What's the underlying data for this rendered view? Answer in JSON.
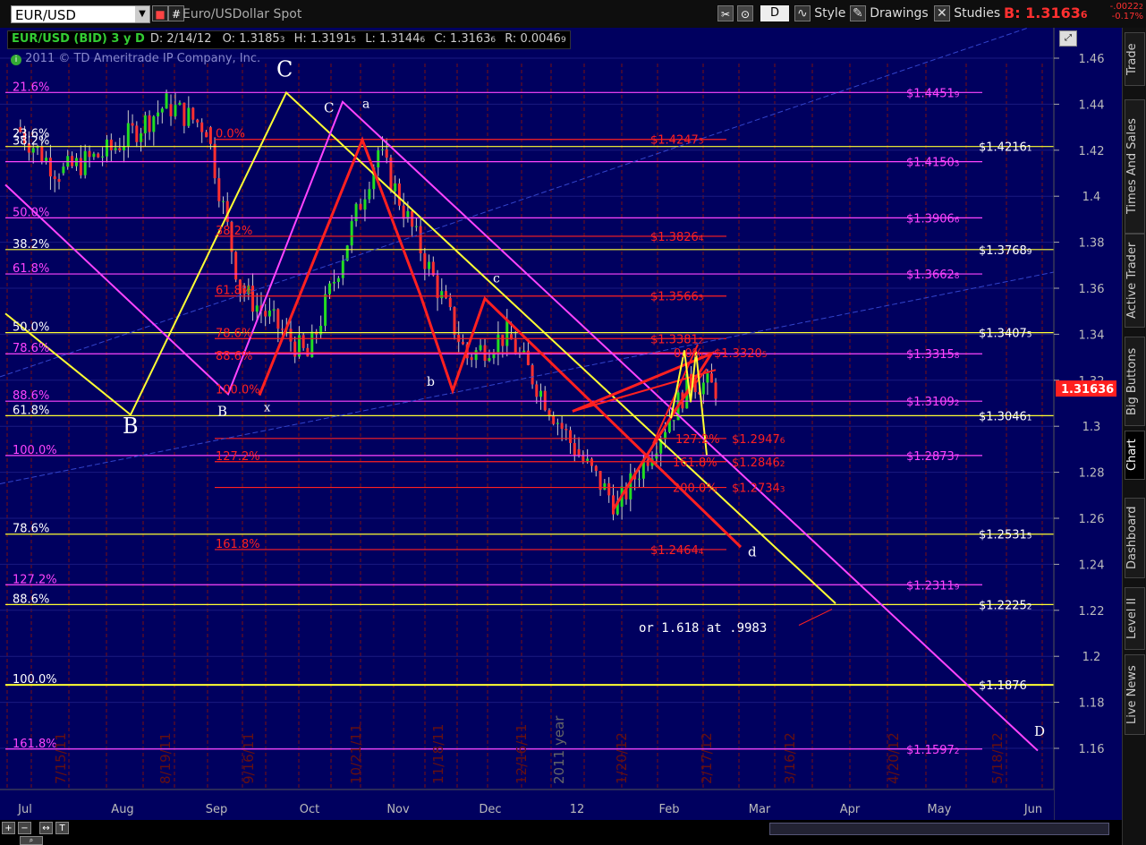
{
  "toolbar": {
    "symbol": "EUR/USD",
    "description": "Euro/USDollar Spot",
    "period_btn": "D",
    "style_label": "Style",
    "drawings_label": "Drawings",
    "studies_label": "Studies",
    "bid_label": "B: 1.3163",
    "bid_sub": "6",
    "change": "-.0022",
    "change_sub": "2",
    "change_pct": "-0.17%"
  },
  "header": {
    "title": "EUR/USD (BID) 3 y D",
    "date": "D: 2/14/12",
    "open": "O: 1.3185",
    "open_sub": "3",
    "high": "H: 1.3191",
    "high_sub": "5",
    "low": "L: 1.3144",
    "low_sub": "6",
    "close": "C: 1.3163",
    "close_sub": "6",
    "range": "R: 0.0046",
    "range_sub": "9",
    "copyright": "2011 © TD Ameritrade IP Company, Inc."
  },
  "sidebar": {
    "tabs": [
      "Trade",
      "Times And Sales",
      "Active Trader",
      "Big Buttons",
      "Chart",
      "Dashboard",
      "Level II",
      "Live News"
    ],
    "active": "Chart"
  },
  "colors": {
    "background": "#00005f",
    "grid": "#7a1010",
    "yellow": "#ffff33",
    "magenta": "#ff44ff",
    "red": "#ff2020",
    "price_box": "#ff2020"
  },
  "chart_data": {
    "type": "candlestick",
    "symbol": "EUR/USD (BID)",
    "ylim": [
      1.155,
      1.475
    ],
    "y_ticks": [
      "1.46",
      "1.44",
      "1.42",
      "1.4",
      "1.38",
      "1.36",
      "1.34",
      "1.32",
      "1.3",
      "1.28",
      "1.26",
      "1.24",
      "1.22",
      "1.2",
      "1.18",
      "1.16"
    ],
    "x_month_labels": [
      "Jul",
      "Aug",
      "Sep",
      "Oct",
      "Nov",
      "Dec",
      "12",
      "Feb",
      "Mar",
      "Apr",
      "May",
      "Jun"
    ],
    "x_date_labels": [
      "7/15/11",
      "8/19/11",
      "9/16/11",
      "10/21/11",
      "11/18/11",
      "12/16/11",
      "2011 year",
      "1/20/12",
      "2/17/12",
      "3/16/12",
      "4/20/12",
      "5/18/12"
    ],
    "last_price": "1.3163",
    "last_price_sub": "6",
    "candles_approx": [
      {
        "date": "2011-07-01",
        "close": 1.43
      },
      {
        "date": "2011-07-15",
        "close": 1.41
      },
      {
        "date": "2011-08-01",
        "close": 1.42
      },
      {
        "date": "2011-08-19",
        "close": 1.44
      },
      {
        "date": "2011-09-01",
        "close": 1.43
      },
      {
        "date": "2011-09-12",
        "close": 1.36
      },
      {
        "date": "2011-10-04",
        "close": 1.33
      },
      {
        "date": "2011-10-27",
        "close": 1.42
      },
      {
        "date": "2011-11-25",
        "close": 1.33
      },
      {
        "date": "2011-12-08",
        "close": 1.34
      },
      {
        "date": "2011-12-30",
        "close": 1.29
      },
      {
        "date": "2012-01-13",
        "close": 1.265
      },
      {
        "date": "2012-02-06",
        "close": 1.32
      },
      {
        "date": "2012-02-14",
        "close": 1.3164
      }
    ],
    "right_price_labels": [
      {
        "text": "$1.4451",
        "sub": "9",
        "price": 1.4451,
        "color": "magenta"
      },
      {
        "text": "$1.4247",
        "sub": "3",
        "price": 1.4247,
        "color": "red"
      },
      {
        "text": "$1.4150",
        "sub": "3",
        "price": 1.415,
        "color": "magenta"
      },
      {
        "text": "$1.3906",
        "sub": "6",
        "price": 1.3906,
        "color": "magenta"
      },
      {
        "text": "$1.3826",
        "sub": "4",
        "price": 1.3826,
        "color": "red"
      },
      {
        "text": "$1.3662",
        "sub": "8",
        "price": 1.3662,
        "color": "magenta"
      },
      {
        "text": "$1.3566",
        "sub": "3",
        "price": 1.3566,
        "color": "red"
      },
      {
        "text": "$1.3381",
        "sub": "2",
        "price": 1.3381,
        "color": "red"
      },
      {
        "text": "$1.3315",
        "sub": "8",
        "price": 1.3315,
        "color": "magenta"
      },
      {
        "text": "$1.3320",
        "sub": "5",
        "price": 1.332,
        "color": "red"
      },
      {
        "text": "$1.3109",
        "sub": "2",
        "price": 1.3109,
        "color": "magenta"
      },
      {
        "text": "$1.2947",
        "sub": "6",
        "price": 1.2947,
        "color": "red"
      },
      {
        "text": "$1.2873",
        "sub": "7",
        "price": 1.2873,
        "color": "magenta"
      },
      {
        "text": "$1.2846",
        "sub": "2",
        "price": 1.2846,
        "color": "red"
      },
      {
        "text": "$1.2734",
        "sub": "3",
        "price": 1.2734,
        "color": "red"
      },
      {
        "text": "$1.2464",
        "sub": "4",
        "price": 1.2464,
        "color": "red"
      },
      {
        "text": "$1.2311",
        "sub": "9",
        "price": 1.2311,
        "color": "magenta"
      },
      {
        "text": "$1.1597",
        "sub": "2",
        "price": 1.1597,
        "color": "magenta"
      },
      {
        "text": "$1.4216",
        "sub": "1",
        "price": 1.4216,
        "color": "yellow"
      },
      {
        "text": "$1.3768",
        "sub": "9",
        "price": 1.3768,
        "color": "yellow"
      },
      {
        "text": "$1.3407",
        "sub": "5",
        "price": 1.3407,
        "color": "yellow"
      },
      {
        "text": "$1.3046",
        "sub": "1",
        "price": 1.3046,
        "color": "yellow"
      },
      {
        "text": "$1.2531",
        "sub": "5",
        "price": 1.2531,
        "color": "yellow"
      },
      {
        "text": "$1.2225",
        "sub": "2",
        "price": 1.2225,
        "color": "yellow"
      },
      {
        "text": "$1.1876",
        "sub": "",
        "price": 1.1876,
        "color": "yellow"
      }
    ],
    "fib_labels_left": [
      {
        "text": "23.6%",
        "price": 1.4247,
        "color": "yellow"
      },
      {
        "text": "38.2%",
        "price": 1.4216,
        "color": "yellow"
      },
      {
        "text": "50.0%",
        "price": 1.3906,
        "color": "magenta"
      },
      {
        "text": "38.2%",
        "price": 1.3768,
        "color": "yellow"
      },
      {
        "text": "61.8%",
        "price": 1.3662,
        "color": "magenta"
      },
      {
        "text": "50.0%",
        "price": 1.3407,
        "color": "yellow"
      },
      {
        "text": "78.6%",
        "price": 1.3315,
        "color": "magenta"
      },
      {
        "text": "88.6%",
        "price": 1.3109,
        "color": "magenta"
      },
      {
        "text": "61.8%",
        "price": 1.3046,
        "color": "yellow"
      },
      {
        "text": "100.0%",
        "price": 1.2873,
        "color": "magenta"
      },
      {
        "text": "78.6%",
        "price": 1.2531,
        "color": "yellow"
      },
      {
        "text": "127.2%",
        "price": 1.2311,
        "color": "magenta"
      },
      {
        "text": "88.6%",
        "price": 1.2225,
        "color": "yellow"
      },
      {
        "text": "100.0%",
        "price": 1.1876,
        "color": "yellow"
      },
      {
        "text": "161.8%",
        "price": 1.1597,
        "color": "magenta"
      },
      {
        "text": "21.6%",
        "price": 1.4451,
        "color": "magenta"
      }
    ],
    "fib_labels_mid": [
      {
        "text": "0.0%",
        "price": 1.4247
      },
      {
        "text": "38.2%",
        "price": 1.3826
      },
      {
        "text": "61.8%",
        "price": 1.3566
      },
      {
        "text": "78.6%",
        "price": 1.3381
      },
      {
        "text": "88.6%",
        "price": 1.3281
      },
      {
        "text": "100.0%",
        "price": 1.3135
      },
      {
        "text": "127.2%",
        "price": 1.2846
      },
      {
        "text": "161.8%",
        "price": 1.2464
      }
    ],
    "fib_labels_recent": [
      {
        "text": "0.0%",
        "price": 1.332
      },
      {
        "text": "127.2%",
        "price": 1.2947
      },
      {
        "text": "161.8%",
        "price": 1.2846
      },
      {
        "text": "200.0%",
        "price": 1.2734
      }
    ],
    "wave_labels": [
      "C",
      "C",
      "a",
      "B",
      "B",
      "x",
      "b",
      "c",
      "d",
      "D"
    ],
    "annotation": "or 1.618 at .9983"
  }
}
